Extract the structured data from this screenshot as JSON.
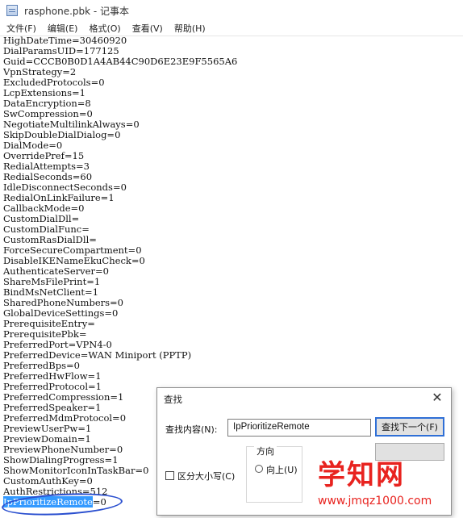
{
  "window": {
    "title": "rasphone.pbk - 记事本"
  },
  "menu": [
    "文件(F)",
    "编辑(E)",
    "格式(O)",
    "查看(V)",
    "帮助(H)"
  ],
  "lines": [
    "HighDateTime=30460920",
    "DialParamsUID=177125",
    "Guid=CCCB0B0D1A4AB44C90D6E23E9F5565A6",
    "VpnStrategy=2",
    "ExcludedProtocols=0",
    "LcpExtensions=1",
    "DataEncryption=8",
    "SwCompression=0",
    "NegotiateMultilinkAlways=0",
    "SkipDoubleDialDialog=0",
    "DialMode=0",
    "OverridePref=15",
    "RedialAttempts=3",
    "RedialSeconds=60",
    "IdleDisconnectSeconds=0",
    "RedialOnLinkFailure=1",
    "CallbackMode=0",
    "CustomDialDll=",
    "CustomDialFunc=",
    "CustomRasDialDll=",
    "ForceSecureCompartment=0",
    "DisableIKENameEkuCheck=0",
    "AuthenticateServer=0",
    "ShareMsFilePrint=1",
    "BindMsNetClient=1",
    "SharedPhoneNumbers=0",
    "GlobalDeviceSettings=0",
    "PrerequisiteEntry=",
    "PrerequisitePbk=",
    "PreferredPort=VPN4-0",
    "PreferredDevice=WAN Miniport (PPTP)",
    "PreferredBps=0",
    "PreferredHwFlow=1",
    "PreferredProtocol=1",
    "PreferredCompression=1",
    "PreferredSpeaker=1",
    "PreferredMdmProtocol=0",
    "PreviewUserPw=1",
    "PreviewDomain=1",
    "PreviewPhoneNumber=0",
    "ShowDialingProgress=1",
    "ShowMonitorIconInTaskBar=0",
    "CustomAuthKey=0",
    "AuthRestrictions=512"
  ],
  "last_line": {
    "selected": "IpPrioritizeRemote",
    "rest": "=0"
  },
  "find_dialog": {
    "title": "查找",
    "close": "✕",
    "find_label": "查找内容(N):",
    "find_value": "IpPrioritizeRemote",
    "find_next": "查找下一个(F)",
    "direction_label": "方向",
    "up_label": "向上(U)",
    "match_case": "区分大小写(C)"
  },
  "watermark": {
    "main": "学知网",
    "sub": "www.jmqz1000.com"
  }
}
